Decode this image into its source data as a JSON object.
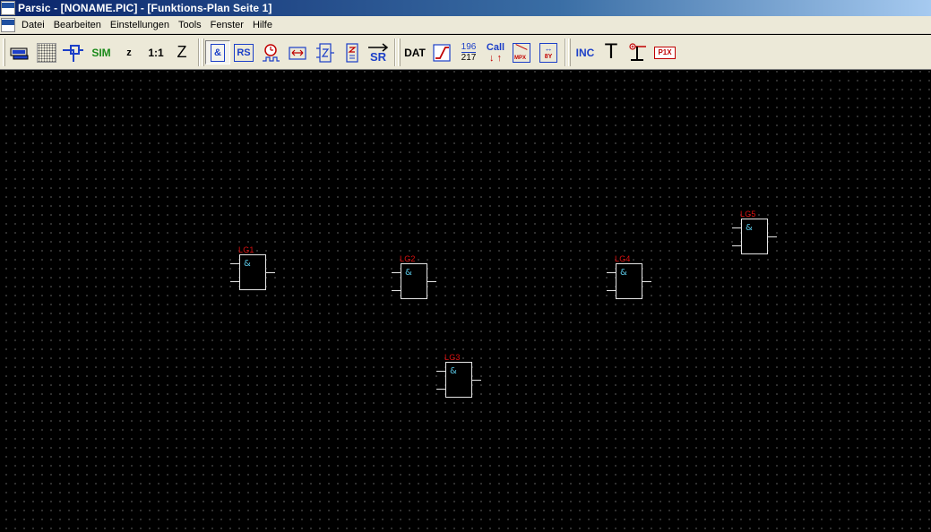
{
  "window": {
    "title": "Parsic - [NONAME.PIC] - [Funktions-Plan Seite 1]",
    "icon_text": "Parsic"
  },
  "menu": {
    "items": [
      "Datei",
      "Bearbeiten",
      "Einstellungen",
      "Tools",
      "Fenster",
      "Hilfe"
    ]
  },
  "toolbar": {
    "sim_label": "SIM",
    "z_small_label": "z",
    "zoom_label": "1:1",
    "z_big_label": "Z",
    "and_label": "&",
    "rs_label": "RS",
    "sr_label": "SR",
    "dat_label": "DAT",
    "count_top": "196",
    "count_bottom": "217",
    "call_label": "Call",
    "mpx_label": "MPX",
    "byte_label": "8Y",
    "inc_label": "INC",
    "text_tool_label": "T",
    "p1x_label": "P1X"
  },
  "gates": [
    {
      "label": "LG1",
      "symbol": "&"
    },
    {
      "label": "LG2",
      "symbol": "&"
    },
    {
      "label": "LG3",
      "symbol": "&"
    },
    {
      "label": "LG4",
      "symbol": "&"
    },
    {
      "label": "LG5",
      "symbol": "&"
    }
  ],
  "colors": {
    "canvas": "#000000",
    "grid_dot": "#5a5a5a",
    "gate_label": "#e01010",
    "gate_symbol": "#5bc8e6",
    "gate_outline": "#e6e6e6",
    "toolbar_blue": "#1c3fc8",
    "toolbar_green": "#1a8a1a"
  }
}
